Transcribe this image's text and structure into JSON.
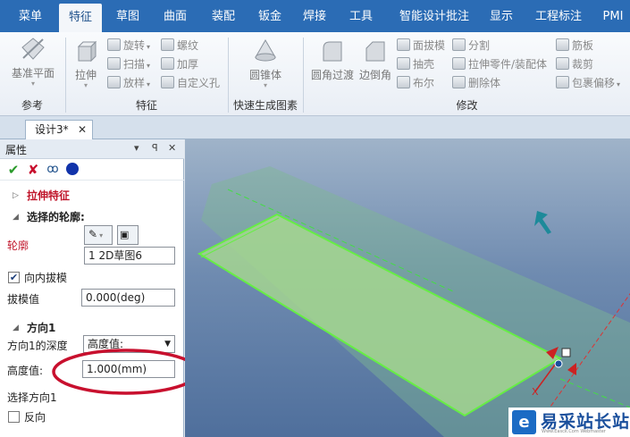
{
  "menu_tabs": [
    "菜单",
    "特征",
    "草图",
    "曲面",
    "装配",
    "钣金",
    "焊接",
    "工具",
    "智能设计批注",
    "显示",
    "工程标注",
    "PMI"
  ],
  "ribbon": {
    "groups": {
      "reference": {
        "label": "参考",
        "base_plane": "基准平面"
      },
      "features": {
        "label": "特征",
        "extrude": "拉伸",
        "revolve": "旋转",
        "sweep": "扫描",
        "loft": "放样",
        "thread": "螺纹",
        "thicken": "加厚",
        "custom_hole": "自定义孔"
      },
      "quick": {
        "label": "快速生成图素",
        "cone": "圆锥体"
      },
      "modify": {
        "label": "修改",
        "fillet": "圆角过渡",
        "chamfer": "边倒角",
        "face_draft": "面拔模",
        "shell": "抽壳",
        "boolean": "布尔",
        "split": "分割",
        "extrude_to_part": "拉伸零件/装配体",
        "delete_body": "删除体",
        "rib": "筋板",
        "trim": "裁剪",
        "wrap_offset": "包裹偏移"
      }
    }
  },
  "document_tab": {
    "title": "设计3*",
    "close": "✕"
  },
  "panel": {
    "title": "属性",
    "pin": "▾  ꟼ  ✕",
    "feature_title": "拉伸特征",
    "section_profile": "选择的轮廓:",
    "profile_label": "轮廓",
    "profile_value": "1    2D草图6",
    "draft_inward_label": "向内拔模",
    "draft_inward_checked": true,
    "draft_value_label": "拔模值",
    "draft_value": "0.000(deg)",
    "section_dir1": "方向1",
    "depth_label": "方向1的深度",
    "depth_option": "高度值:",
    "height_label": "高度值:",
    "height_value": "1.000(mm)",
    "select_dir_label": "选择方向1",
    "reverse_label": "反向",
    "reverse_checked": false
  },
  "viewport_axis_label": "X",
  "watermark": {
    "logo": "e",
    "name": "易采站长站",
    "sub": "Www.Easck.Com Webmaster"
  },
  "colors": {
    "menu_bg": "#2b6cb5",
    "feature_title": "#c0162b",
    "highlight_oval": "#c8102e",
    "extrude_green": "#66ee44"
  }
}
